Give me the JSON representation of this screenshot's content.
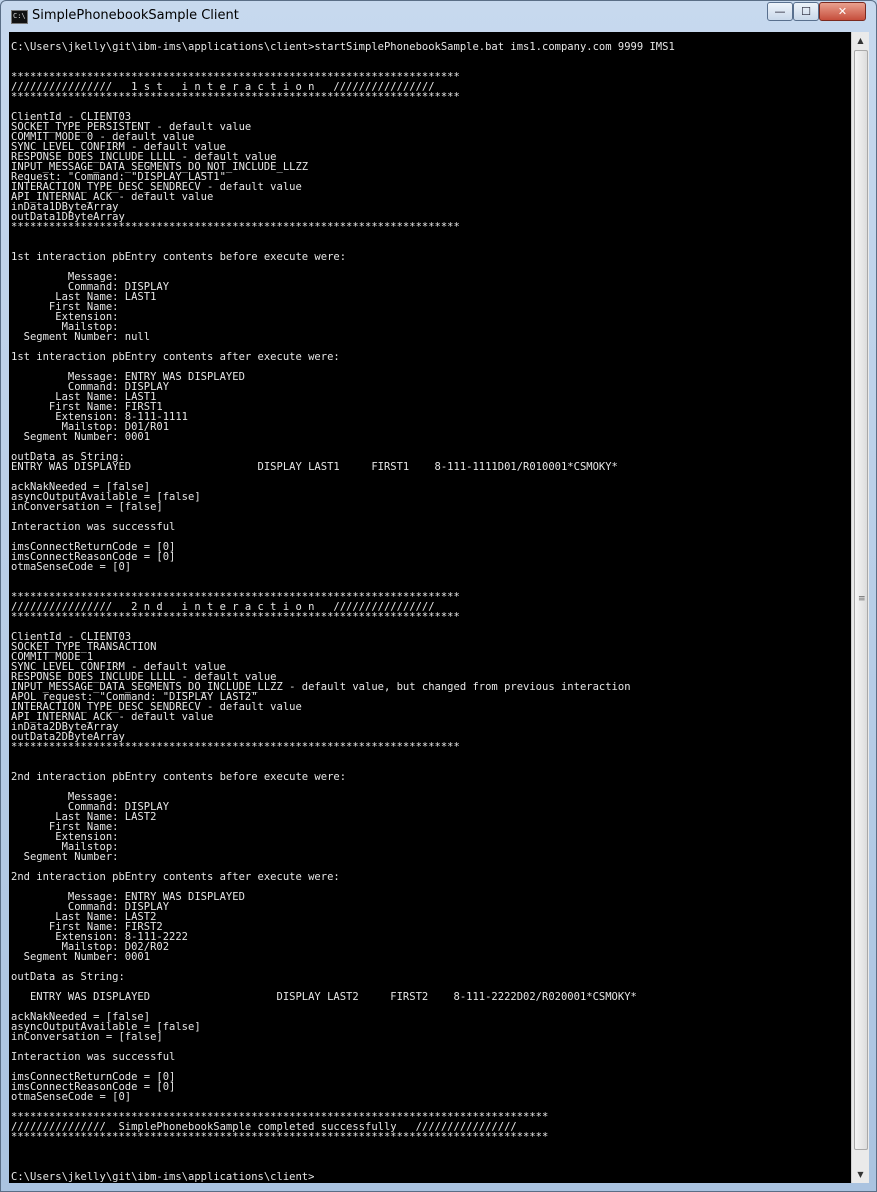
{
  "window": {
    "title": "SimplePhonebookSample Client",
    "controls": {
      "minimize": "—",
      "maximize": "☐",
      "close": "✕"
    }
  },
  "scrollbar": {
    "up": "▲",
    "down": "▼",
    "grip": "≡"
  },
  "console_lines": [
    "",
    "C:\\Users\\jkelly\\git\\ibm-ims\\applications\\client>startSimplePhonebookSample.bat ims1.company.com 9999 IMS1",
    "",
    "",
    "***********************************************************************",
    "////////////////   1 s t   i n t e r a c t i o n   ////////////////",
    "***********************************************************************",
    "",
    "ClientId - CLIENT03",
    "SOCKET_TYPE_PERSISTENT - default value",
    "COMMIT_MODE_0 - default value",
    "SYNC_LEVEL_CONFIRM - default value",
    "RESPONSE_DOES_INCLUDE_LLLL - default value",
    "INPUT_MESSAGE_DATA_SEGMENTS_DO_NOT_INCLUDE_LLZZ",
    "Request: \"Command: \"DISPLAY LAST1\"",
    "INTERACTION_TYPE_DESC_SENDRECV - default value",
    "API_INTERNAL_ACK - default value",
    "inData1DByteArray",
    "outData1DByteArray",
    "***********************************************************************",
    "",
    "",
    "1st interaction pbEntry contents before execute were:",
    "",
    "         Message:",
    "         Command: DISPLAY",
    "       Last Name: LAST1",
    "      First Name:",
    "       Extension:",
    "        Mailstop:",
    "  Segment Number: null",
    "",
    "1st interaction pbEntry contents after execute were:",
    "",
    "         Message: ENTRY WAS DISPLAYED",
    "         Command: DISPLAY",
    "       Last Name: LAST1",
    "      First Name: FIRST1",
    "       Extension: 8-111-1111",
    "        Mailstop: D01/R01",
    "  Segment Number: 0001",
    "",
    "outData as String:",
    "ENTRY WAS DISPLAYED                    DISPLAY LAST1     FIRST1    8-111-1111D01/R010001*CSMOKY*",
    "",
    "ackNakNeeded = [false]",
    "asyncOutputAvailable = [false]",
    "inConversation = [false]",
    "",
    "Interaction was successful",
    "",
    "imsConnectReturnCode = [0]",
    "imsConnectReasonCode = [0]",
    "otmaSenseCode = [0]",
    "",
    "",
    "***********************************************************************",
    "////////////////   2 n d   i n t e r a c t i o n   ////////////////",
    "***********************************************************************",
    "",
    "ClientId - CLIENT03",
    "SOCKET_TYPE_TRANSACTION",
    "COMMIT_MODE_1",
    "SYNC_LEVEL_CONFIRM - default value",
    "RESPONSE_DOES_INCLUDE_LLLL - default value",
    "INPUT_MESSAGE_DATA_SEGMENTS_DO_INCLUDE_LLZZ - default value, but changed from previous interaction",
    "APOL request: \"Command: \"DISPLAY LAST2\"",
    "INTERACTION_TYPE_DESC_SENDRECV - default value",
    "API_INTERNAL_ACK - default value",
    "inData2DByteArray",
    "outData2DByteArray",
    "***********************************************************************",
    "",
    "",
    "2nd interaction pbEntry contents before execute were:",
    "",
    "         Message:",
    "         Command: DISPLAY",
    "       Last Name: LAST2",
    "      First Name:",
    "       Extension:",
    "        Mailstop:",
    "  Segment Number:",
    "",
    "2nd interaction pbEntry contents after execute were:",
    "",
    "         Message: ENTRY WAS DISPLAYED",
    "         Command: DISPLAY",
    "       Last Name: LAST2",
    "      First Name: FIRST2",
    "       Extension: 8-111-2222",
    "        Mailstop: D02/R02",
    "  Segment Number: 0001",
    "",
    "outData as String:",
    "",
    "   ENTRY WAS DISPLAYED                    DISPLAY LAST2     FIRST2    8-111-2222D02/R020001*CSMOKY*",
    "",
    "ackNakNeeded = [false]",
    "asyncOutputAvailable = [false]",
    "inConversation = [false]",
    "",
    "Interaction was successful",
    "",
    "imsConnectReturnCode = [0]",
    "imsConnectReasonCode = [0]",
    "otmaSenseCode = [0]",
    "",
    "*************************************************************************************",
    "///////////////  SimplePhonebookSample completed successfully   ////////////////",
    "*************************************************************************************",
    "",
    "",
    "",
    "C:\\Users\\jkelly\\git\\ibm-ims\\applications\\client>"
  ]
}
